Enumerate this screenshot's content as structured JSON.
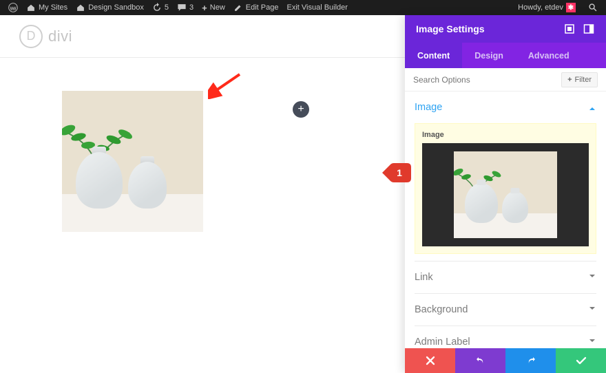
{
  "adminbar": {
    "my_sites": "My Sites",
    "site_name": "Design Sandbox",
    "updates_count": "5",
    "comments_count": "3",
    "new": "New",
    "edit_page": "Edit Page",
    "exit_vb": "Exit Visual Builder",
    "howdy": "Howdy, etdev"
  },
  "brand": {
    "text": "divi",
    "logo_letter": "D"
  },
  "panel": {
    "title": "Image Settings",
    "tabs": {
      "content": "Content",
      "design": "Design",
      "advanced": "Advanced",
      "active": "content"
    },
    "search_placeholder": "Search Options",
    "filter_label": "Filter",
    "sections": {
      "image": "Image",
      "link": "Link",
      "background": "Background",
      "admin_label": "Admin Label"
    },
    "image_field_label": "Image"
  },
  "annotation": {
    "badge": "1"
  },
  "colors": {
    "panel_primary": "#6b26d9",
    "panel_secondary": "#8224e3",
    "accent_blue": "#2ea3f2",
    "footer_red": "#ef5350",
    "footer_purple": "#7e3bd0",
    "footer_blue": "#1f8feb",
    "footer_green": "#34c77b"
  }
}
